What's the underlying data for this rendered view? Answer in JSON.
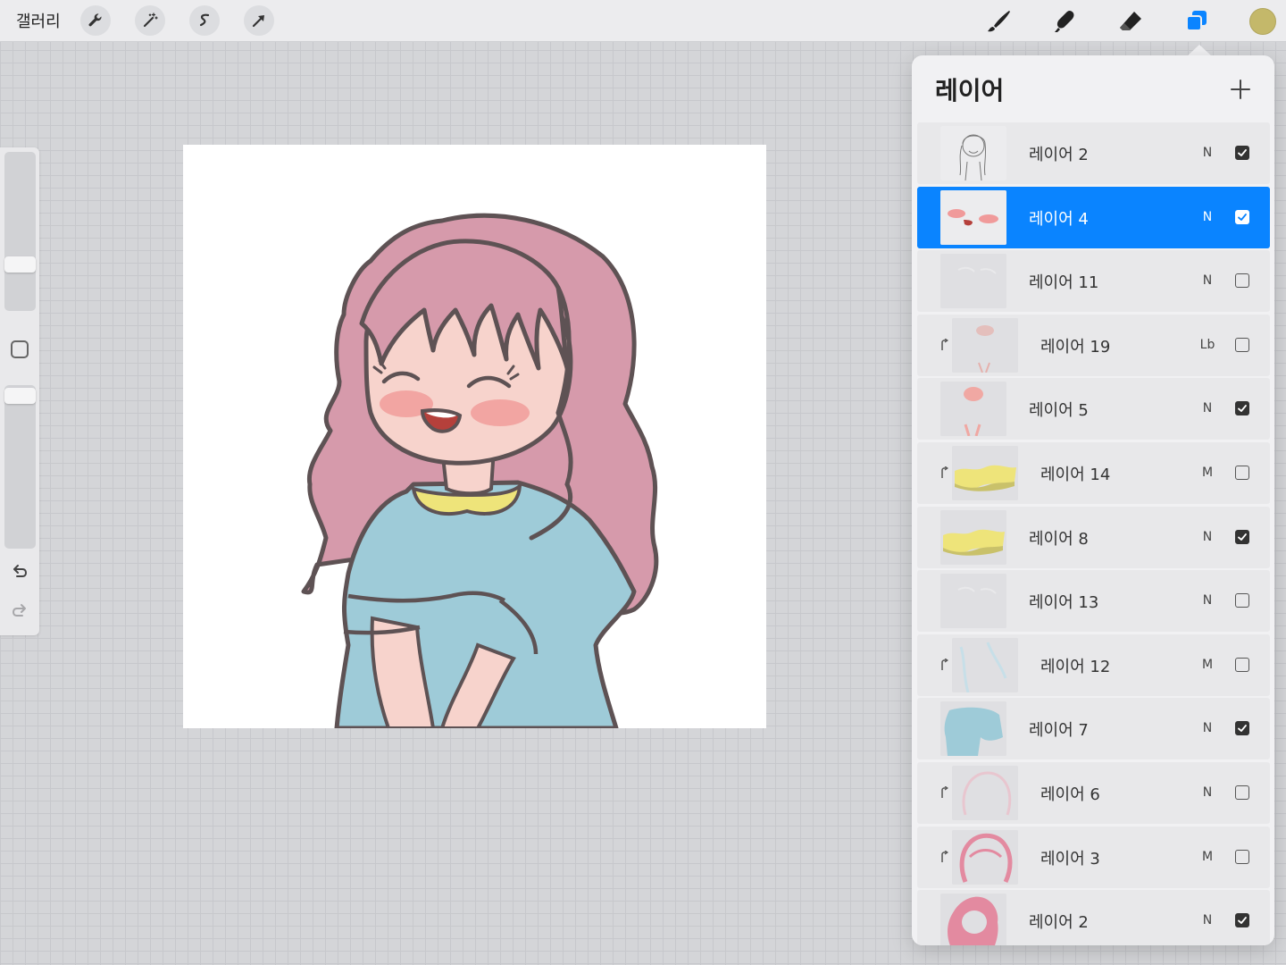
{
  "topbar": {
    "gallery_label": "갤러리",
    "left_tools": [
      "wrench-icon",
      "magic-wand-icon",
      "selection-s-icon",
      "transform-arrow-icon"
    ],
    "right_tools": [
      "brush-icon",
      "smudge-icon",
      "eraser-icon",
      "layers-icon"
    ],
    "active_color": "#c4b86a"
  },
  "sidebar": {
    "brush_size_level": 0.27,
    "opacity_level": 0.02
  },
  "layers_panel": {
    "title": "레이어",
    "add_icon": "plus-icon",
    "layers": [
      {
        "name": "레이어 2",
        "blend": "N",
        "visible": true,
        "clipped": false,
        "selected": false,
        "thumb": "sketch"
      },
      {
        "name": "레이어 4",
        "blend": "N",
        "visible": true,
        "clipped": false,
        "selected": true,
        "thumb": "blush"
      },
      {
        "name": "레이어 11",
        "blend": "N",
        "visible": false,
        "clipped": false,
        "selected": false,
        "thumb": "faint"
      },
      {
        "name": "레이어 19",
        "blend": "Lb",
        "visible": false,
        "clipped": true,
        "selected": false,
        "thumb": "faint-red"
      },
      {
        "name": "레이어 5",
        "blend": "N",
        "visible": true,
        "clipped": false,
        "selected": false,
        "thumb": "skin"
      },
      {
        "name": "레이어 14",
        "blend": "M",
        "visible": false,
        "clipped": true,
        "selected": false,
        "thumb": "yellow"
      },
      {
        "name": "레이어 8",
        "blend": "N",
        "visible": true,
        "clipped": false,
        "selected": false,
        "thumb": "yellow"
      },
      {
        "name": "레이어 13",
        "blend": "N",
        "visible": false,
        "clipped": false,
        "selected": false,
        "thumb": "faint"
      },
      {
        "name": "레이어 12",
        "blend": "M",
        "visible": false,
        "clipped": true,
        "selected": false,
        "thumb": "faint-blue"
      },
      {
        "name": "레이어 7",
        "blend": "N",
        "visible": true,
        "clipped": false,
        "selected": false,
        "thumb": "blue"
      },
      {
        "name": "레이어 6",
        "blend": "N",
        "visible": false,
        "clipped": true,
        "selected": false,
        "thumb": "faint-pink"
      },
      {
        "name": "레이어 3",
        "blend": "M",
        "visible": false,
        "clipped": true,
        "selected": false,
        "thumb": "pink"
      },
      {
        "name": "레이어 2",
        "blend": "N",
        "visible": true,
        "clipped": false,
        "selected": false,
        "thumb": "hair"
      }
    ]
  }
}
